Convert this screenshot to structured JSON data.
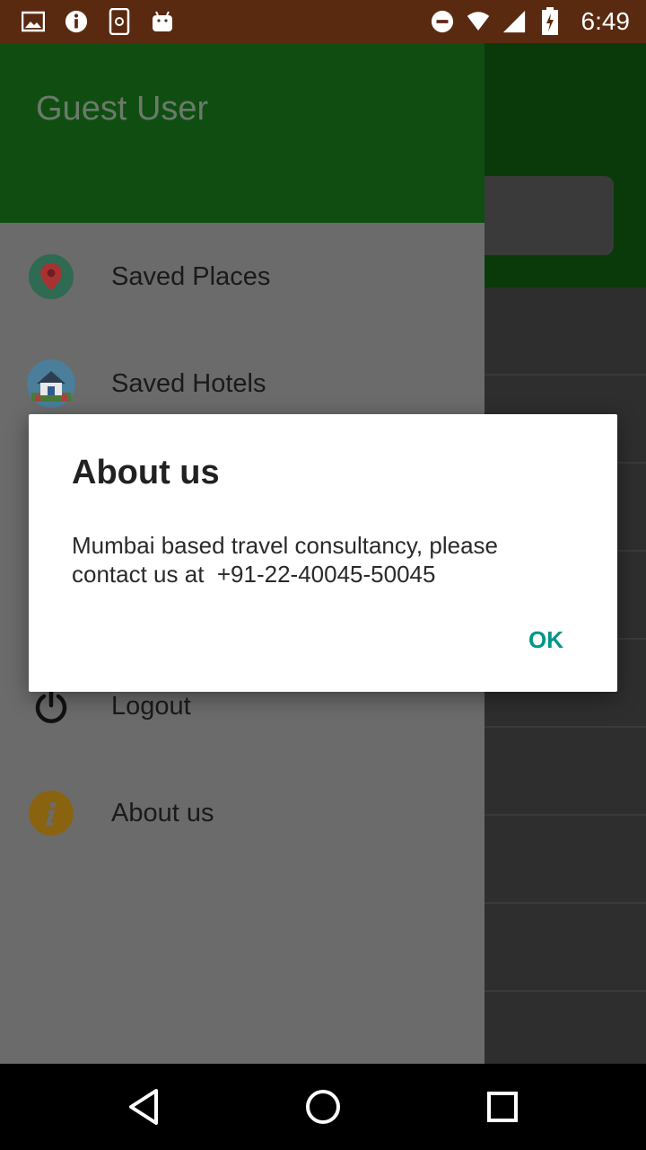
{
  "status_bar": {
    "time": "6:49",
    "icons_left": [
      "image-icon",
      "info-icon",
      "phone-sync-icon",
      "android-icon"
    ],
    "icons_right": [
      "do-not-disturb-icon",
      "wifi-icon",
      "cell-signal-icon",
      "battery-charging-icon"
    ],
    "bg_color": "#5a2a10"
  },
  "drawer": {
    "user_name": "Guest User",
    "header_color": "#0f4e10",
    "items": [
      {
        "label": "Saved Places",
        "icon": "map-pin-icon"
      },
      {
        "label": "Saved Hotels",
        "icon": "house-icon"
      },
      {
        "label": "Logout",
        "icon": "power-icon"
      },
      {
        "label": "About us",
        "icon": "info-circle-icon"
      }
    ]
  },
  "dialog": {
    "title": "About us",
    "message": "Mumbai based travel consultancy, please\ncontact us at  +91-22-40045-50045",
    "ok_label": "OK",
    "accent_color": "#009688"
  },
  "nav_bar": {
    "buttons": [
      "back-icon",
      "home-icon",
      "recents-icon"
    ]
  }
}
